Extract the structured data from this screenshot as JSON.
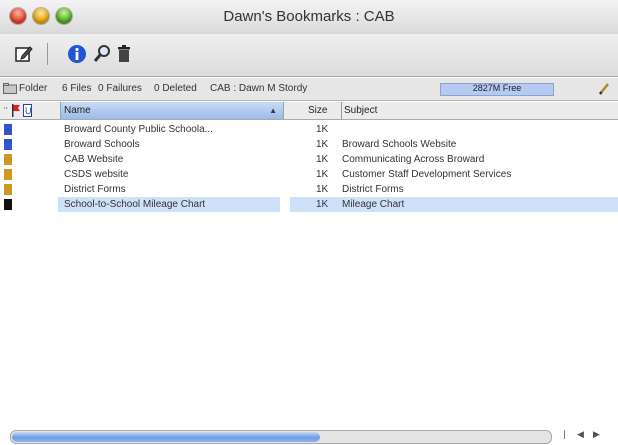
{
  "window": {
    "title": "Dawn's Bookmarks : CAB"
  },
  "toolbar": {
    "icons": [
      "compose-icon",
      "info-icon",
      "search-icon",
      "trash-icon"
    ]
  },
  "status": {
    "folder_label": "Folder",
    "files": "6 Files",
    "failures": "0 Failures",
    "deleted": "0 Deleted",
    "account": "CAB : Dawn M Stordy",
    "free": "2827M Free"
  },
  "columns": {
    "name": "Name",
    "size": "Size",
    "subject": "Subject"
  },
  "rows": [
    {
      "name": "Broward County Public Schoola...",
      "size": "1K",
      "subject": "",
      "icon_color": "#3355cc"
    },
    {
      "name": "Broward Schools",
      "size": "1K",
      "subject": "Broward Schools Website",
      "icon_color": "#3355cc"
    },
    {
      "name": "CAB Website",
      "size": "1K",
      "subject": "Communicating Across Broward",
      "icon_color": "#cc9a22"
    },
    {
      "name": "CSDS website",
      "size": "1K",
      "subject": "Customer Staff Development Services",
      "icon_color": "#cc9a22"
    },
    {
      "name": "District Forms",
      "size": "1K",
      "subject": "District Forms",
      "icon_color": "#cc9a22"
    },
    {
      "name": "School-to-School Mileage Chart",
      "size": "1K",
      "subject": "Mileage Chart",
      "icon_color": "#111111"
    }
  ],
  "selected_row": 5,
  "colors": {
    "selection": "#cfe0fa",
    "accent": "#6f9ee3"
  }
}
